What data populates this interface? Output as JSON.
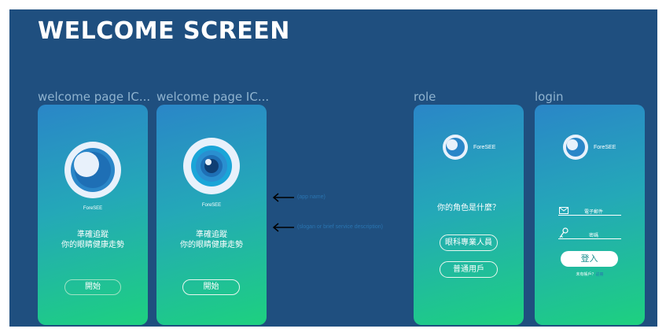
{
  "title": "WELCOME SCREEN",
  "frames": [
    {
      "label": "welcome page IC...",
      "brand": "ForeSEE",
      "tagline_1": "準確追蹤",
      "tagline_2": "你的眼睛健康走勢",
      "button": "開始"
    },
    {
      "label": "welcome page IC...",
      "brand": "ForeSEE",
      "tagline_1": "準確追蹤",
      "tagline_2": "你的眼睛健康走勢",
      "button": "開始"
    },
    {
      "label": "role",
      "brand": "ForeSEE",
      "question": "你的角色是什麼？",
      "option_1": "眼科專業人員",
      "option_2": "普通用戶"
    },
    {
      "label": "login",
      "brand": "ForeSEE",
      "email_label": "電子郵件",
      "password_label": "密碼",
      "button": "登入",
      "signup_prompt": "未有帳戶？",
      "signup_link": "註冊"
    }
  ],
  "annotations": {
    "app_name": "(app name)",
    "slogan": "(slogan or brief service description)"
  },
  "colors": {
    "background": "#1f4f7f",
    "gradient_top": "#2a86c8",
    "gradient_bottom": "#1dd17f",
    "annotation": "#2a74b0"
  },
  "icons": [
    "eye-logo-icon",
    "eye-logo-icon",
    "eye-logo-icon",
    "eye-logo-icon",
    "arrow-left-icon",
    "arrow-left-icon",
    "mail-icon",
    "key-icon"
  ]
}
